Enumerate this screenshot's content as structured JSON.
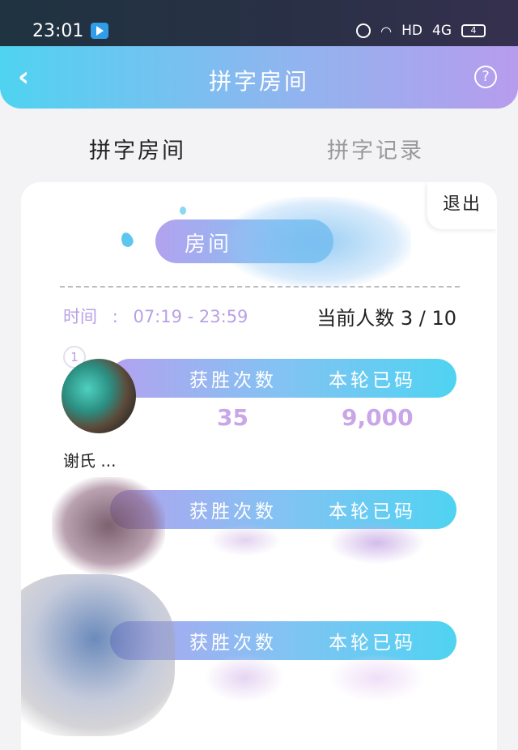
{
  "status_bar": {
    "time": "23:01",
    "network": "HD",
    "signal": "4G",
    "battery": "4"
  },
  "header": {
    "back_icon": "chevron-left-icon",
    "title": "拼字房间",
    "help_icon": "question-circle-icon",
    "help_glyph": "?"
  },
  "tabs": [
    {
      "label": "拼字房间",
      "active": true
    },
    {
      "label": "拼字记录",
      "active": false
    }
  ],
  "room": {
    "exit_label": "退出",
    "room_label": "房间",
    "time_label": "时间",
    "time_value": "07:19 - 23:59",
    "count_label": "当前人数",
    "count_value": "3 / 10"
  },
  "players": [
    {
      "rank": "1",
      "wins_label": "获胜次数",
      "round_label": "本轮已码",
      "wins": "35",
      "round": "9,000",
      "name": "谢氏 ..."
    },
    {
      "wins_label": "获胜次数",
      "round_label": "本轮已码"
    },
    {
      "wins_label": "获胜次数",
      "round_label": "本轮已码"
    }
  ],
  "colors": {
    "header_gradient_start": "#4fd3f1",
    "header_gradient_end": "#b79ced",
    "accent_purple": "#b9a0e6",
    "stat_value": "#c9a6e8"
  }
}
